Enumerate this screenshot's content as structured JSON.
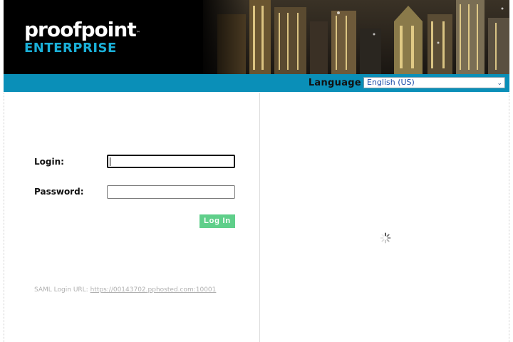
{
  "header": {
    "logo_main": "proofpoint",
    "logo_tm": "™",
    "logo_sub": "ENTERPRISE"
  },
  "language_bar": {
    "label": "Language",
    "selected": "English (US)",
    "chevron_icon": "chevron-down-icon"
  },
  "login_form": {
    "login_label": "Login:",
    "login_value": "",
    "password_label": "Password:",
    "password_value": "",
    "submit_label": "Log In"
  },
  "saml": {
    "label": "SAML Login URL:",
    "url": "https://00143702.pphosted.com:10001"
  },
  "right_panel": {
    "loading_icon": "loading-spinner-icon"
  },
  "colors": {
    "banner_background": "#000000",
    "language_bar": "#0a8fb8",
    "logo_accent": "#1ab0d8",
    "login_button": "#5fcf8a"
  }
}
